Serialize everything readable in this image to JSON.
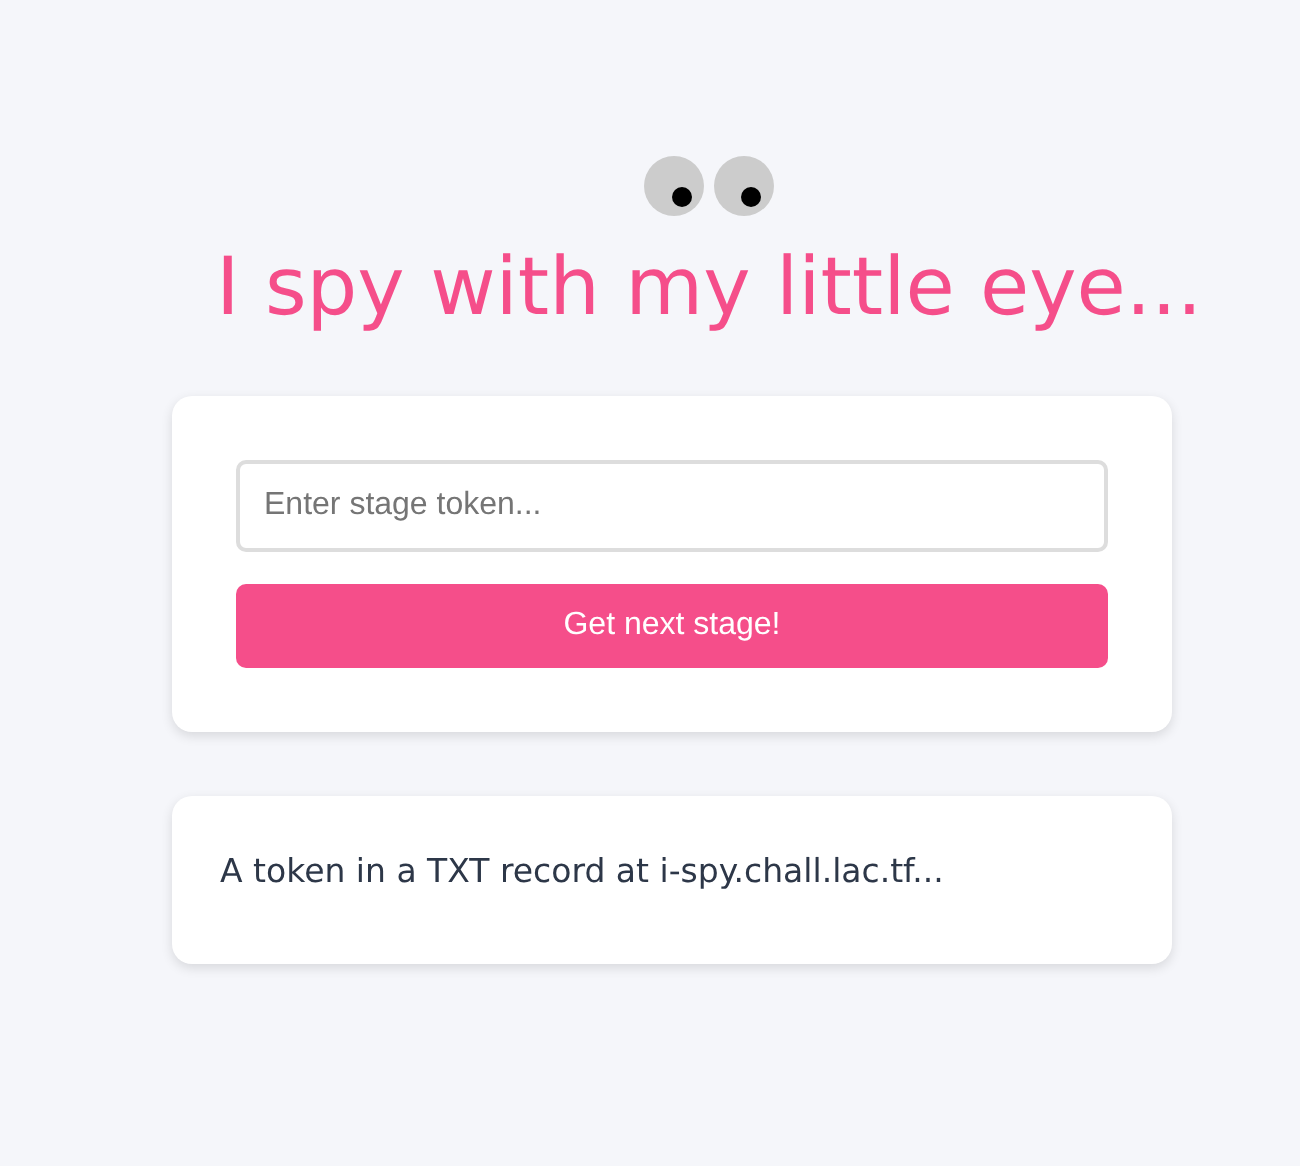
{
  "title": "I spy with my little eye...",
  "token_field": {
    "placeholder": "Enter stage token..."
  },
  "submit_button": {
    "label": "Get next stage!"
  },
  "message": "A token in a TXT record at i-spy.chall.lac.tf..."
}
